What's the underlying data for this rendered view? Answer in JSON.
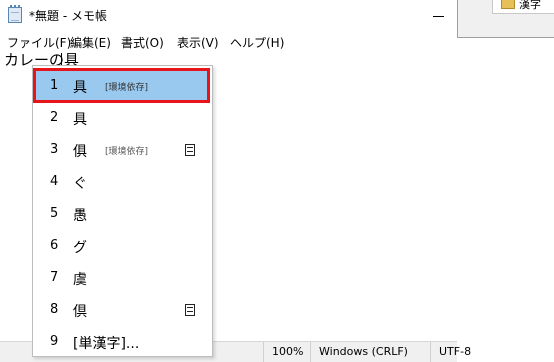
{
  "background_window": {
    "folder_label": "漢字"
  },
  "window": {
    "title": "*無題 - メモ帳"
  },
  "menu": [
    {
      "label": "ファイル(F)"
    },
    {
      "label": "編集(E)"
    },
    {
      "label": "書式(O)"
    },
    {
      "label": "表示(V)"
    },
    {
      "label": "ヘルプ(H)"
    }
  ],
  "editor": {
    "text": "カレーの具"
  },
  "candidates": [
    {
      "num": "1",
      "char": "具",
      "note": "[環境依存]",
      "dict": false,
      "selected": true
    },
    {
      "num": "2",
      "char": "具",
      "note": "",
      "dict": false,
      "selected": false
    },
    {
      "num": "3",
      "char": "俱",
      "note": "[環境依存]",
      "dict": true,
      "selected": false
    },
    {
      "num": "4",
      "char": "ぐ",
      "note": "",
      "dict": false,
      "selected": false
    },
    {
      "num": "5",
      "char": "愚",
      "note": "",
      "dict": false,
      "selected": false
    },
    {
      "num": "6",
      "char": "グ",
      "note": "",
      "dict": false,
      "selected": false
    },
    {
      "num": "7",
      "char": "虞",
      "note": "",
      "dict": false,
      "selected": false
    },
    {
      "num": "8",
      "char": "倶",
      "note": "",
      "dict": true,
      "selected": false
    },
    {
      "num": "9",
      "char": "[単漢字]...",
      "note": "",
      "dict": false,
      "selected": false
    }
  ],
  "status": {
    "zoom": "100%",
    "line_ending": "Windows (CRLF)",
    "encoding": "UTF-8"
  },
  "colors": {
    "selection": "#99c9ef",
    "highlight_frame": "#e8141b"
  }
}
